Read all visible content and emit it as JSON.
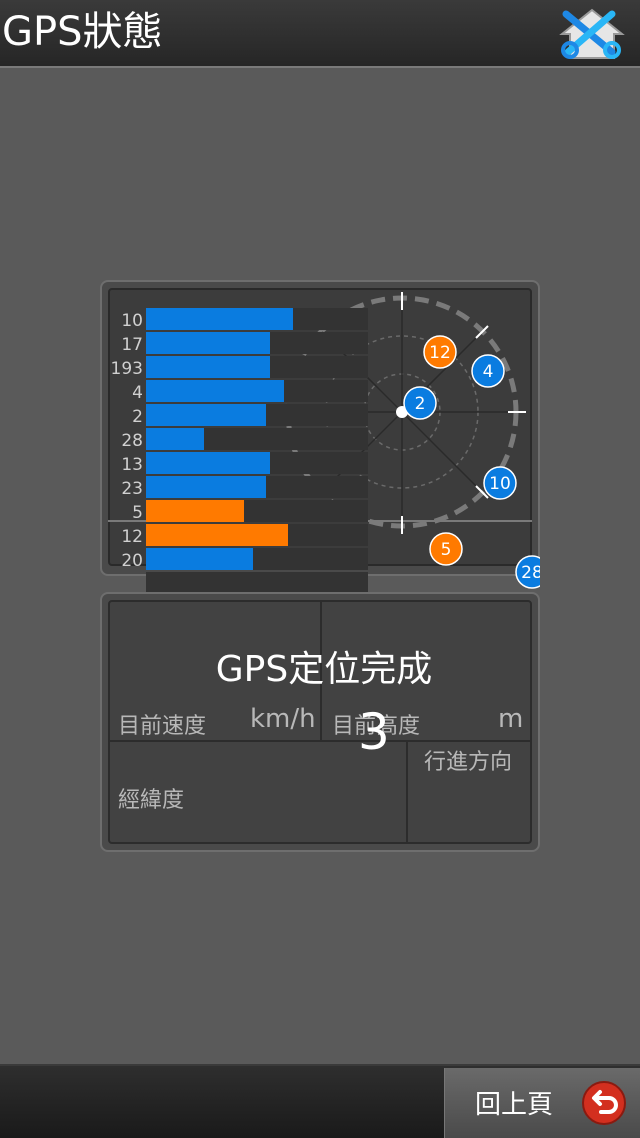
{
  "header": {
    "title": "GPS狀態"
  },
  "icons": {
    "home": "home-tools-icon",
    "back": "back-arrow-icon"
  },
  "satellites": {
    "bars": [
      {
        "id": "10",
        "level": 0.66,
        "color": "#0a7ce0"
      },
      {
        "id": "17",
        "level": 0.56,
        "color": "#0a7ce0"
      },
      {
        "id": "193",
        "level": 0.56,
        "color": "#0a7ce0"
      },
      {
        "id": "4",
        "level": 0.62,
        "color": "#0a7ce0"
      },
      {
        "id": "2",
        "level": 0.54,
        "color": "#0a7ce0"
      },
      {
        "id": "28",
        "level": 0.26,
        "color": "#0a7ce0"
      },
      {
        "id": "13",
        "level": 0.56,
        "color": "#0a7ce0"
      },
      {
        "id": "23",
        "level": 0.54,
        "color": "#0a7ce0"
      },
      {
        "id": "5",
        "level": 0.44,
        "color": "#ff7a00"
      },
      {
        "id": "12",
        "level": 0.64,
        "color": "#ff7a00"
      },
      {
        "id": "20",
        "level": 0.48,
        "color": "#0a7ce0"
      }
    ],
    "sky": [
      {
        "id": "12",
        "color": "#ff7a00"
      },
      {
        "id": "4",
        "color": "#0a7ce0"
      },
      {
        "id": "2",
        "color": "#0a7ce0"
      },
      {
        "id": "10",
        "color": "#0a7ce0"
      },
      {
        "id": "5",
        "color": "#ff7a00"
      },
      {
        "id": "28",
        "color": "#0a7ce0"
      }
    ]
  },
  "info": {
    "status": "GPS定位完成",
    "speed_label": "目前速度",
    "speed_unit": "km/h",
    "altitude_label": "目前高度",
    "altitude_unit": "m",
    "sat_count": "3",
    "heading_label": "行進方向",
    "coords_label": "經緯度"
  },
  "footer": {
    "back_label": "回上頁"
  }
}
